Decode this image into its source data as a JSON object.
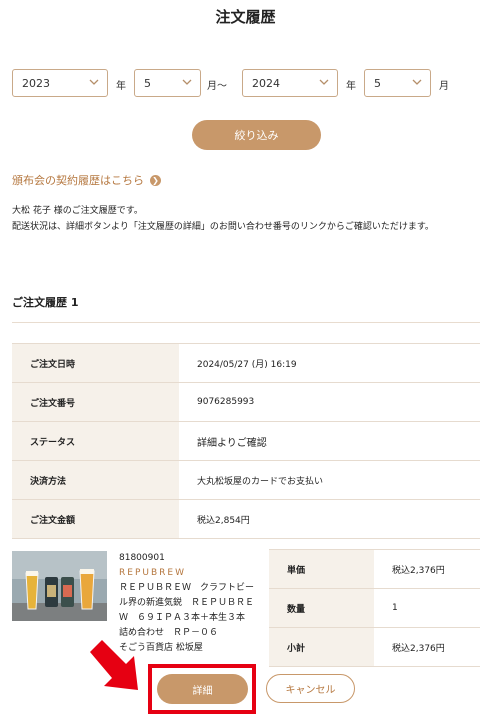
{
  "page": {
    "title": "注文履歴"
  },
  "filter": {
    "from_year": "2023",
    "from_month": "5",
    "to_year": "2024",
    "to_month": "5",
    "year_unit": "年",
    "month_range_unit": "月～",
    "month_unit": "月",
    "submit_label": "絞り込み"
  },
  "subscription_link": {
    "label": "頒布会の契約履歴はこちら",
    "icon": "chevron-right-circle-icon"
  },
  "greeting": {
    "line1": "大松 花子 様のご注文履歴です。",
    "line2": "配送状況は、詳細ボタンより「注文履歴の詳細」のお問い合わせ番号のリンクからご確認いただけます。"
  },
  "order": {
    "heading": "ご注文履歴 1",
    "rows": [
      {
        "label": "ご注文日時",
        "value": "2024/05/27 (月) 16:19"
      },
      {
        "label": "ご注文番号",
        "value": "9076285993"
      },
      {
        "label": "ステータス",
        "value": "詳細よりご確認"
      },
      {
        "label": "決済方法",
        "value": "大丸松坂屋のカードでお支払い"
      },
      {
        "label": "ご注文金額",
        "value": "税込2,854円"
      }
    ],
    "item": {
      "code": "81800901",
      "brand": "REPUBREW",
      "name_lines": [
        "ＲＥＰＵＢＲＥＷ　クラフトビー",
        "ル界の新進気鋭　ＲＥＰＵＢＲＥ",
        "Ｗ　６９ＩＰＡ３本＋本生３本",
        "詰め合わせ　ＲＰ－０６"
      ],
      "store": "そごう百貨店 松坂屋",
      "price_rows": [
        {
          "label": "単価",
          "value": "税込2,376円"
        },
        {
          "label": "数量",
          "value": "1"
        },
        {
          "label": "小計",
          "value": "税込2,376円"
        }
      ]
    },
    "actions": {
      "detail_label": "詳細",
      "cancel_label": "キャンセル"
    }
  },
  "colors": {
    "accent": "#c8986a",
    "link": "#b5773f",
    "highlight": "#e60012"
  }
}
